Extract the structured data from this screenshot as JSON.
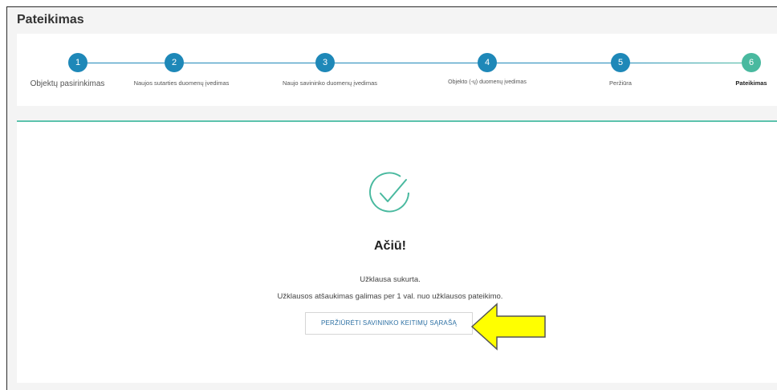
{
  "page": {
    "title": "Pateikimas"
  },
  "colors": {
    "step_active": "#1e88b8",
    "step_final": "#49b99f",
    "accent": "#5cc3ad",
    "arrow_fill": "#ffff00"
  },
  "stepper": {
    "steps": [
      {
        "number": "1",
        "label": "Objektų pasirinkimas"
      },
      {
        "number": "2",
        "label": "Naujos sutarties duomenų įvedimas"
      },
      {
        "number": "3",
        "label": "Naujo  savininko duomenų įvedimas"
      },
      {
        "number": "4",
        "label": "Objekto (-ų) duomenų įvedimas"
      },
      {
        "number": "5",
        "label": "Peržiūra"
      },
      {
        "number": "6",
        "label": "Pateikimas"
      }
    ]
  },
  "confirmation": {
    "icon": "check-circle-icon",
    "heading": "Ačiū!",
    "message_created": "Užklausa sukurta.",
    "message_cancel": "Užklausos atšaukimas galimas per 1 val. nuo užklausos pateikimo.",
    "button_label": "PERŽIŪRĖTI SAVININKO KEITIMŲ SĄRAŠĄ"
  },
  "annotation": {
    "icon": "arrow-left-icon"
  }
}
